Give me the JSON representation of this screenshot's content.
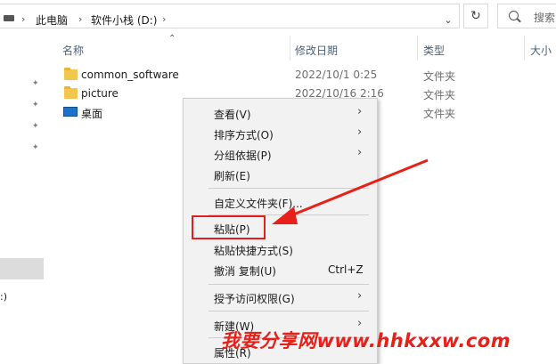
{
  "address_bar": {
    "crumbs": [
      "此电脑",
      "软件小栈 (D:)"
    ],
    "separator": "›",
    "dropdown": "⌄",
    "refresh": "↻",
    "search_placeholder": "搜索"
  },
  "nav_pane": {
    "drive_label": ":)"
  },
  "columns": {
    "name": "名称",
    "modified": "修改日期",
    "type": "类型",
    "size": "大小"
  },
  "files": [
    {
      "name": "common_software",
      "modified": "2022/10/1 0:25",
      "type": "文件夹",
      "icon": "folder-icon"
    },
    {
      "name": "picture",
      "modified": "2022/10/16 2:16",
      "type": "文件夹",
      "icon": "folder-icon"
    },
    {
      "name": "桌面",
      "modified": "",
      "type": "文件夹",
      "icon": "desktop-icon"
    }
  ],
  "context_menu": {
    "view": "查看(V)",
    "sort": "排序方式(O)",
    "group": "分组依据(P)",
    "refresh": "刷新(E)",
    "customize": "自定义文件夹(F)...",
    "paste": "粘贴(P)",
    "paste_shortcut": "粘贴快捷方式(S)",
    "undo": "撤消 复制(U)",
    "undo_shortcut": "Ctrl+Z",
    "give_access": "授予访问权限(G)",
    "new": "新建(W)",
    "properties": "属性(R)",
    "submenu_chevron": "›"
  },
  "annotation": {
    "highlight_color": "#e02020",
    "arrow_color": "#e8201a"
  },
  "watermark": "我要分享网www.hhkxxw.com"
}
